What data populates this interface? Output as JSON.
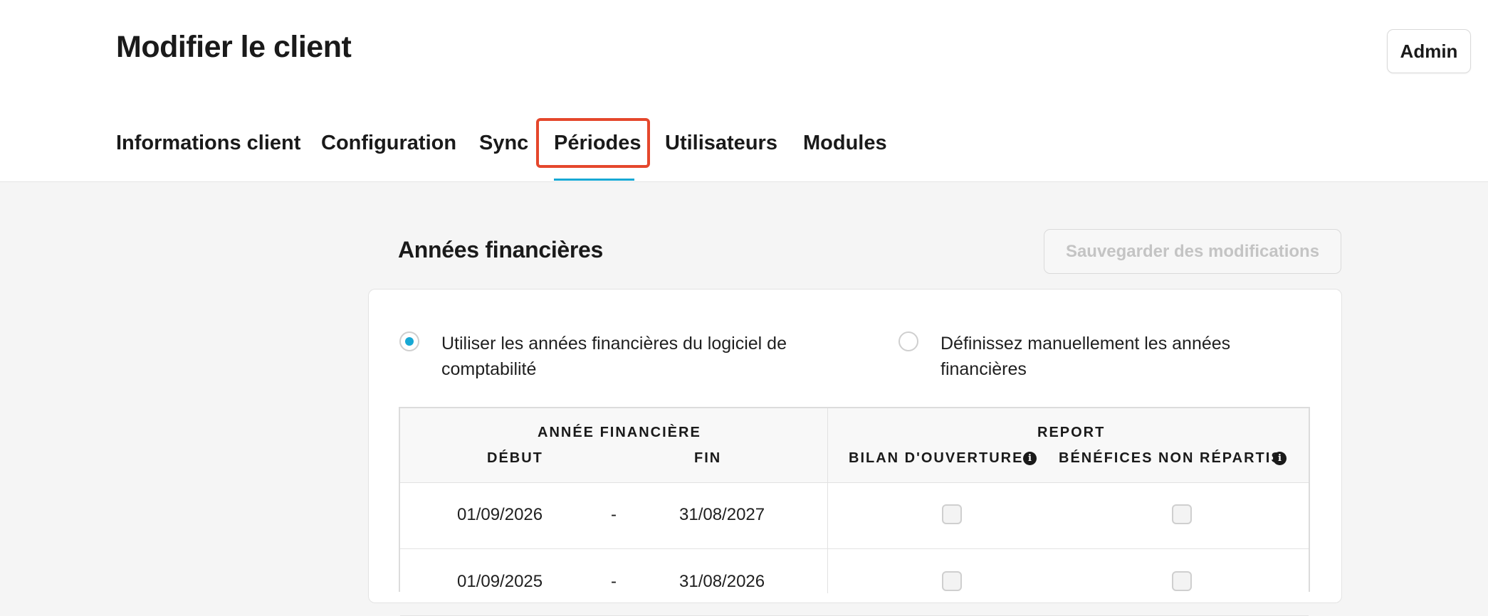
{
  "header": {
    "title": "Modifier le client",
    "admin_label": "Admin"
  },
  "tabs": [
    {
      "label": "Informations client"
    },
    {
      "label": "Configuration"
    },
    {
      "label": "Sync"
    },
    {
      "label": "Périodes",
      "active": true
    },
    {
      "label": "Utilisateurs"
    },
    {
      "label": "Modules"
    }
  ],
  "section": {
    "title": "Années financières",
    "save_label": "Sauvegarder des modifications"
  },
  "options": {
    "software": {
      "line1": "Utiliser les années financières du logiciel de",
      "line2": "comptabilité",
      "checked": true
    },
    "manual": {
      "line1": "Définissez manuellement les années",
      "line2": "financières",
      "checked": false
    }
  },
  "table": {
    "group_financial_year": "ANNÉE FINANCIÈRE",
    "col_start": "DÉBUT",
    "col_end": "FIN",
    "group_report": "REPORT",
    "col_opening": "BILAN D'OUVERTURE",
    "col_retained": "BÉNÉFICES NON RÉPARTIS",
    "rows": [
      {
        "start": "01/09/2026",
        "sep": "-",
        "end": "31/08/2027"
      },
      {
        "start": "01/09/2025",
        "sep": "-",
        "end": "31/08/2026"
      }
    ]
  },
  "colors": {
    "accent": "#17a8d4",
    "highlight": "#e5472c"
  }
}
